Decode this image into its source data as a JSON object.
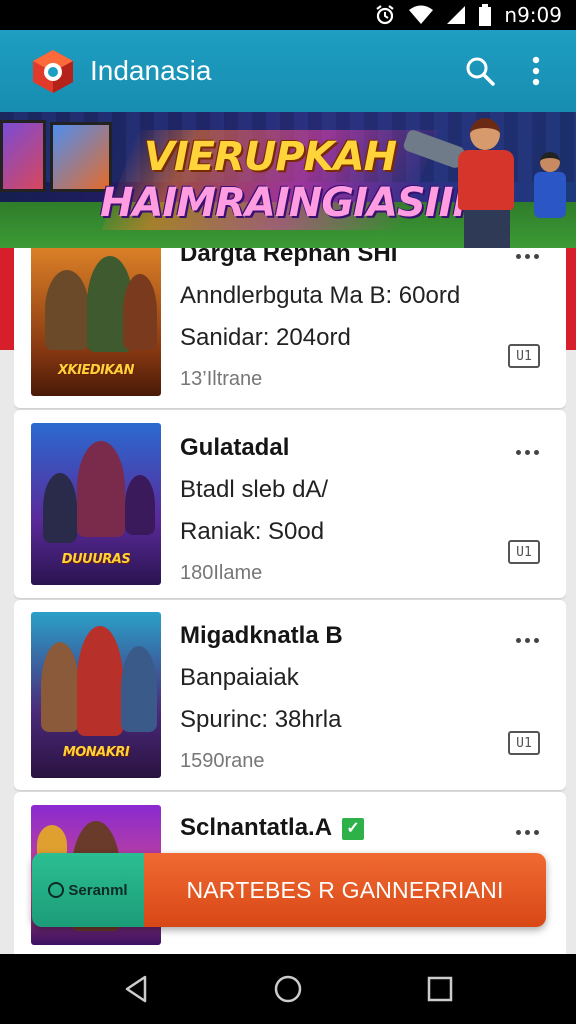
{
  "status_bar": {
    "time": "n9:09",
    "icons": [
      "alarm-icon",
      "wifi-icon",
      "cell-signal-icon",
      "battery-icon"
    ]
  },
  "app_bar": {
    "title": "Indanasia",
    "actions": [
      "search-icon",
      "more-vert-icon"
    ],
    "color": "#1e9ec2"
  },
  "banner": {
    "line1": "VIERUPKAH",
    "line2": "HAIMRAINGIASIIN"
  },
  "cards": [
    {
      "title": "Dargta Rephan SHI",
      "line1": "Anndlerbguta Ma B: 60ord",
      "line2": "Sanidar: 204ord",
      "meta": "13’Iltrane",
      "thumb_text": "XKIEDIKAN",
      "badge": "U1"
    },
    {
      "title": "Gulatadal",
      "line1": "Btadl sleb dA/",
      "line2": "Raniak: S0od",
      "meta": "180Ilame",
      "thumb_text": "DUUURAS",
      "badge": "U1"
    },
    {
      "title": "Migadknatla B",
      "line1": "Banpaiaiak",
      "line2": "Spurinc: 38hrla",
      "meta": "1590rane",
      "thumb_text": "MONAKRI",
      "badge": "U1"
    },
    {
      "title": "Sclnantatla.A",
      "verified": "✓"
    }
  ],
  "cta": {
    "left_label": "Seranml",
    "right_label": "NARTEBES R GANNERRIANI"
  },
  "nav_bar": [
    "back-icon",
    "home-icon",
    "recents-icon"
  ]
}
